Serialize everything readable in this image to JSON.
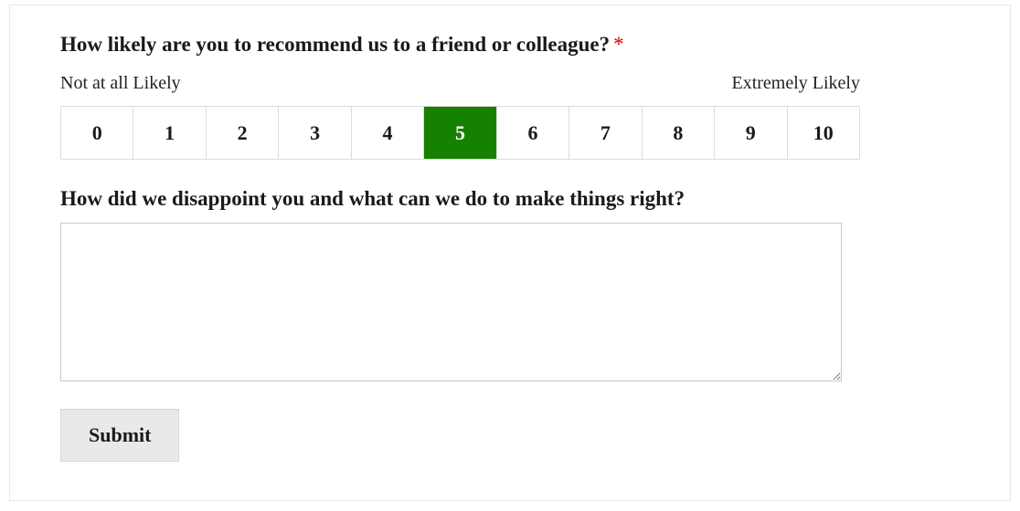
{
  "question": {
    "label": "How likely are you to recommend us to a friend or colleague?",
    "required_mark": "*",
    "scale_low_label": "Not at all Likely",
    "scale_high_label": "Extremely Likely",
    "scale_options": [
      "0",
      "1",
      "2",
      "3",
      "4",
      "5",
      "6",
      "7",
      "8",
      "9",
      "10"
    ],
    "selected_value": "5"
  },
  "followup": {
    "label": "How did we disappoint you and what can we do to make things right?",
    "value": ""
  },
  "submit": {
    "label": "Submit"
  }
}
